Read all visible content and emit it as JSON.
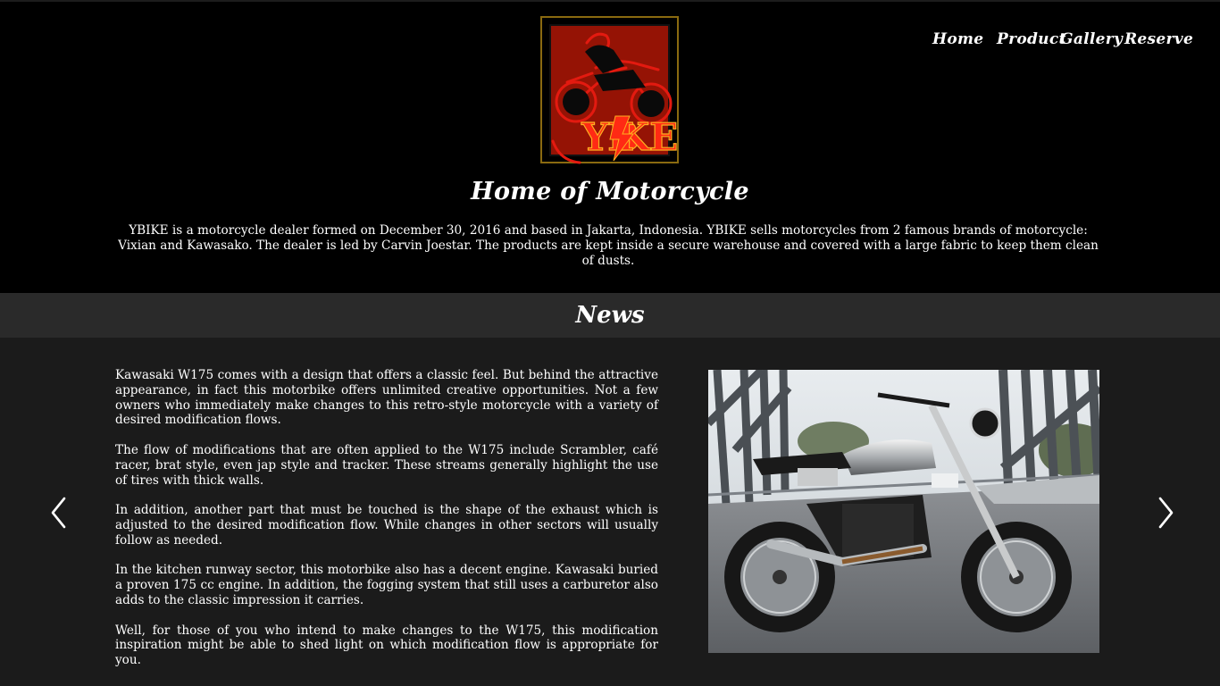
{
  "header": {
    "logo_text": "YBIKE",
    "title": "Home of Motorcycle",
    "intro": "YBIKE is a motorcycle dealer formed on December 30, 2016 and based in Jakarta, Indonesia. YBIKE sells motorcycles from 2 famous brands of motorcycle: Vixian and Kawasako. The dealer is led by Carvin Joestar. The products are kept inside a secure warehouse and covered with a large fabric to keep them clean of dusts."
  },
  "nav": {
    "items": [
      {
        "label": "Home"
      },
      {
        "label": "Product"
      },
      {
        "label": "Gallery"
      },
      {
        "label": "Reserve"
      }
    ]
  },
  "news": {
    "title": "News",
    "paragraphs": [
      "Kawasaki W175 comes with a design that offers a classic feel. But behind the attractive appearance, in fact this motorbike offers unlimited creative opportunities. Not a few owners who immediately make changes to this retro-style motorcycle with a variety of desired modification flows.",
      "The flow of modifications that are often applied to the W175 include Scrambler, café racer, brat style, even jap style and tracker. These streams generally highlight the use of tires with thick walls.",
      "In addition, another part that must be touched is the shape of the exhaust which is adjusted to the desired modification flow. While changes in other sectors will usually follow as needed.",
      "In the kitchen runway sector, this motorbike also has a decent engine. Kawasaki buried a proven 175 cc engine. In addition, the fogging system that still uses a carburetor also adds to the classic impression it carries.",
      "Well, for those of you who intend to make changes to the W175, this modification inspiration might be able to shed light on which modification flow is appropriate for you."
    ]
  },
  "colors": {
    "header_bg": "#000000",
    "news_bar_bg": "#2a2a2a",
    "news_bg": "#1b1b1b",
    "logo_red": "#cc1a10",
    "logo_gold": "#8a6a10"
  },
  "icons": {
    "prev": "chevron-left-icon",
    "next": "chevron-right-icon"
  }
}
